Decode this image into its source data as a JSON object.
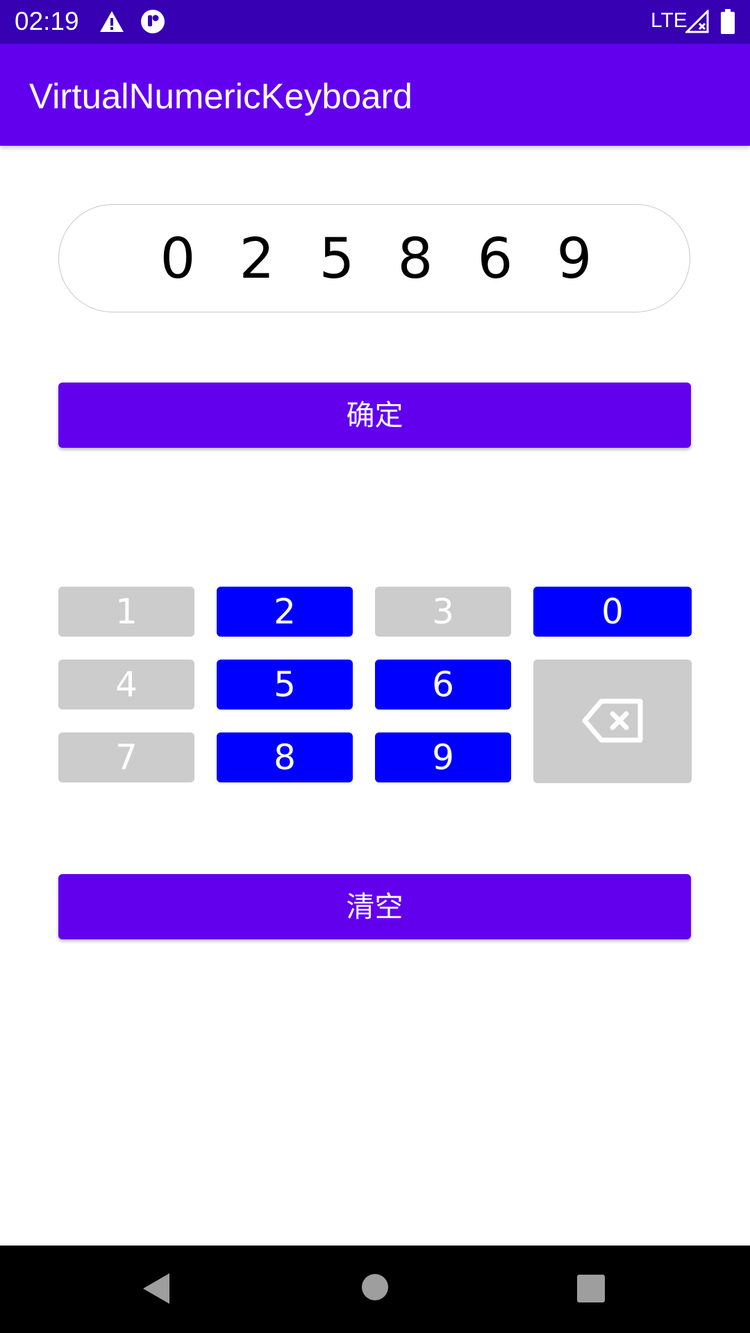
{
  "status_bar": {
    "time": "02:19",
    "network": "LTE",
    "icons": [
      "warning-icon",
      "sync-icon",
      "signal-icon",
      "battery-icon"
    ]
  },
  "app_bar": {
    "title": "VirtualNumericKeyboard",
    "color": "#6200ee"
  },
  "code_display": {
    "digits": [
      "0",
      "2",
      "5",
      "8",
      "6",
      "9"
    ]
  },
  "confirm_button": {
    "label": "确定"
  },
  "keypad": {
    "keys": [
      {
        "label": "1",
        "state": "disabled",
        "color": "#cccccc"
      },
      {
        "label": "2",
        "state": "active",
        "color": "#0000ff"
      },
      {
        "label": "3",
        "state": "disabled",
        "color": "#cccccc"
      },
      {
        "label": "0",
        "state": "active",
        "color": "#0000ff"
      },
      {
        "label": "4",
        "state": "disabled",
        "color": "#cccccc"
      },
      {
        "label": "5",
        "state": "active",
        "color": "#0000ff"
      },
      {
        "label": "6",
        "state": "active",
        "color": "#0000ff"
      },
      {
        "label": "7",
        "state": "disabled",
        "color": "#cccccc"
      },
      {
        "label": "8",
        "state": "active",
        "color": "#0000ff"
      },
      {
        "label": "9",
        "state": "active",
        "color": "#0000ff"
      }
    ],
    "backspace_icon": "backspace-icon"
  },
  "clear_button": {
    "label": "清空"
  },
  "nav_bar": {
    "icons": [
      "back-icon",
      "home-icon",
      "recents-icon"
    ]
  },
  "colors": {
    "status_bar": "#3700b3",
    "primary": "#6200ee",
    "key_active": "#0000ff",
    "key_inactive": "#cccccc"
  }
}
